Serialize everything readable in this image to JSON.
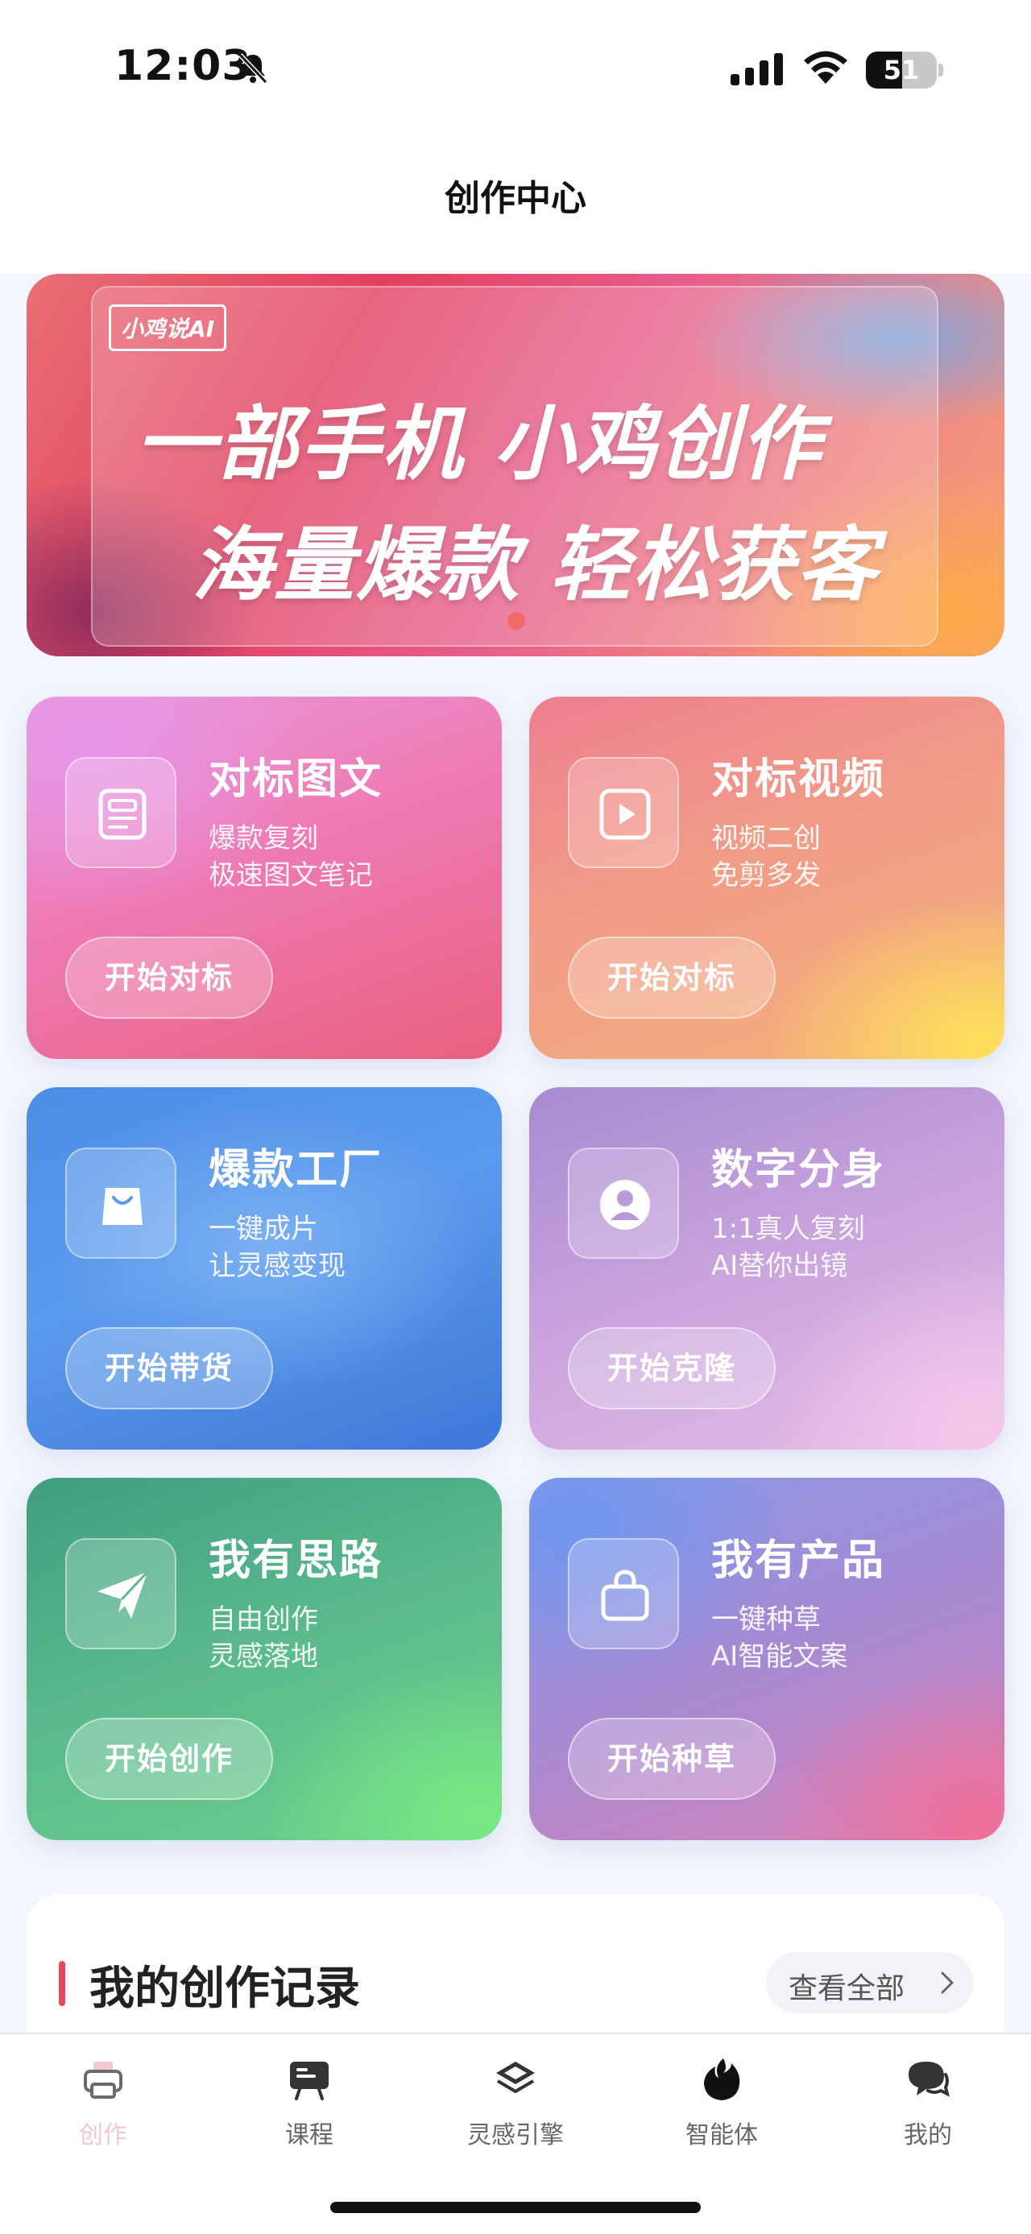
{
  "status_bar": {
    "time": "12:03",
    "battery": "51",
    "battery_level": 0.51
  },
  "header": {
    "title": "创作中心"
  },
  "banner": {
    "logo": "小鸡说AI",
    "line1": "一部手机 小鸡创作",
    "line2": "海量爆款 轻松获客"
  },
  "cards": [
    {
      "title": "对标图文",
      "sub1": "爆款复刻",
      "sub2": "极速图文笔记",
      "button": "开始对标",
      "icon": "document-icon"
    },
    {
      "title": "对标视频",
      "sub1": "视频二创",
      "sub2": "免剪多发",
      "button": "开始对标",
      "icon": "play-icon"
    },
    {
      "title": "爆款工厂",
      "sub1": "一键成片",
      "sub2": "让灵感变现",
      "button": "开始带货",
      "icon": "shopping-bag-icon"
    },
    {
      "title": "数字分身",
      "sub1": "1:1真人复刻",
      "sub2": "AI替你出镜",
      "button": "开始克隆",
      "icon": "user-avatar-icon"
    },
    {
      "title": "我有思路",
      "sub1": "自由创作",
      "sub2": "灵感落地",
      "button": "开始创作",
      "icon": "paper-plane-icon"
    },
    {
      "title": "我有产品",
      "sub1": "一键种草",
      "sub2": "AI智能文案",
      "button": "开始种草",
      "icon": "bag-outline-icon"
    }
  ],
  "records": {
    "title": "我的创作记录",
    "view_all": "查看全部"
  },
  "tabs": [
    {
      "label": "创作",
      "icon": "printer-icon",
      "active": true
    },
    {
      "label": "课程",
      "icon": "presentation-icon",
      "active": false
    },
    {
      "label": "灵感引擎",
      "icon": "layers-icon",
      "active": false
    },
    {
      "label": "智能体",
      "icon": "flame-icon",
      "active": false
    },
    {
      "label": "我的",
      "icon": "chat-bubbles-icon",
      "active": false
    }
  ],
  "colors": {
    "accent": "#e8485a",
    "tab_active": "#f3c8cf",
    "tab_inactive": "#666666"
  }
}
